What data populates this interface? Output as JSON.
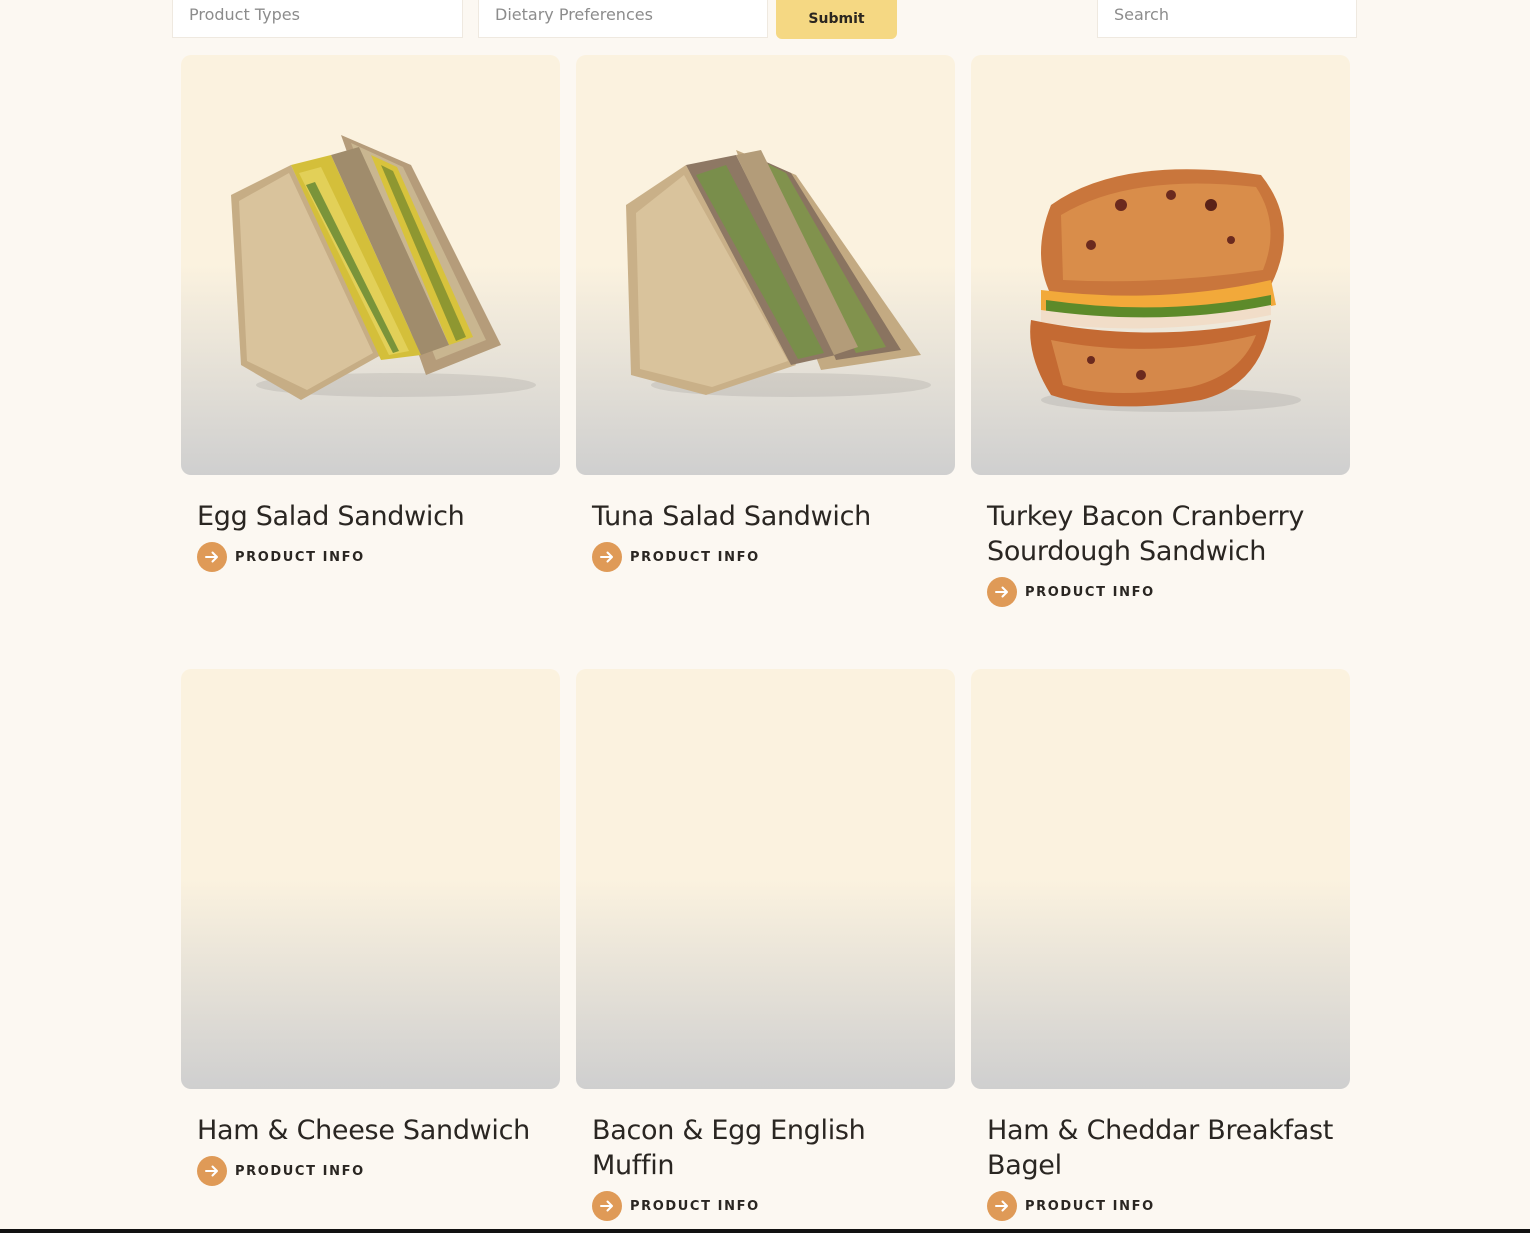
{
  "filters": {
    "product_types_placeholder": "Product Types",
    "dietary_placeholder": "Dietary Preferences",
    "submit_label": "Submit",
    "search_placeholder": "Search"
  },
  "colors": {
    "accent": "#df9a57",
    "submit_bg": "#f5d883",
    "page_bg": "#fcf8f2"
  },
  "products": [
    {
      "title": "Egg Salad Sandwich",
      "link_label": "PRODUCT INFO",
      "image": "egg-salad-sandwich"
    },
    {
      "title": "Tuna Salad Sandwich",
      "link_label": "PRODUCT INFO",
      "image": "tuna-salad-sandwich"
    },
    {
      "title": "Turkey Bacon Cranberry Sourdough Sandwich",
      "link_label": "PRODUCT INFO",
      "image": "grilled-sourdough-sandwich"
    },
    {
      "title": "Ham & Cheese Sandwich",
      "link_label": "PRODUCT INFO",
      "image": null
    },
    {
      "title": "Bacon & Egg English Muffin",
      "link_label": "PRODUCT INFO",
      "image": null
    },
    {
      "title": "Ham & Cheddar Breakfast Bagel",
      "link_label": "PRODUCT INFO",
      "image": null
    }
  ]
}
